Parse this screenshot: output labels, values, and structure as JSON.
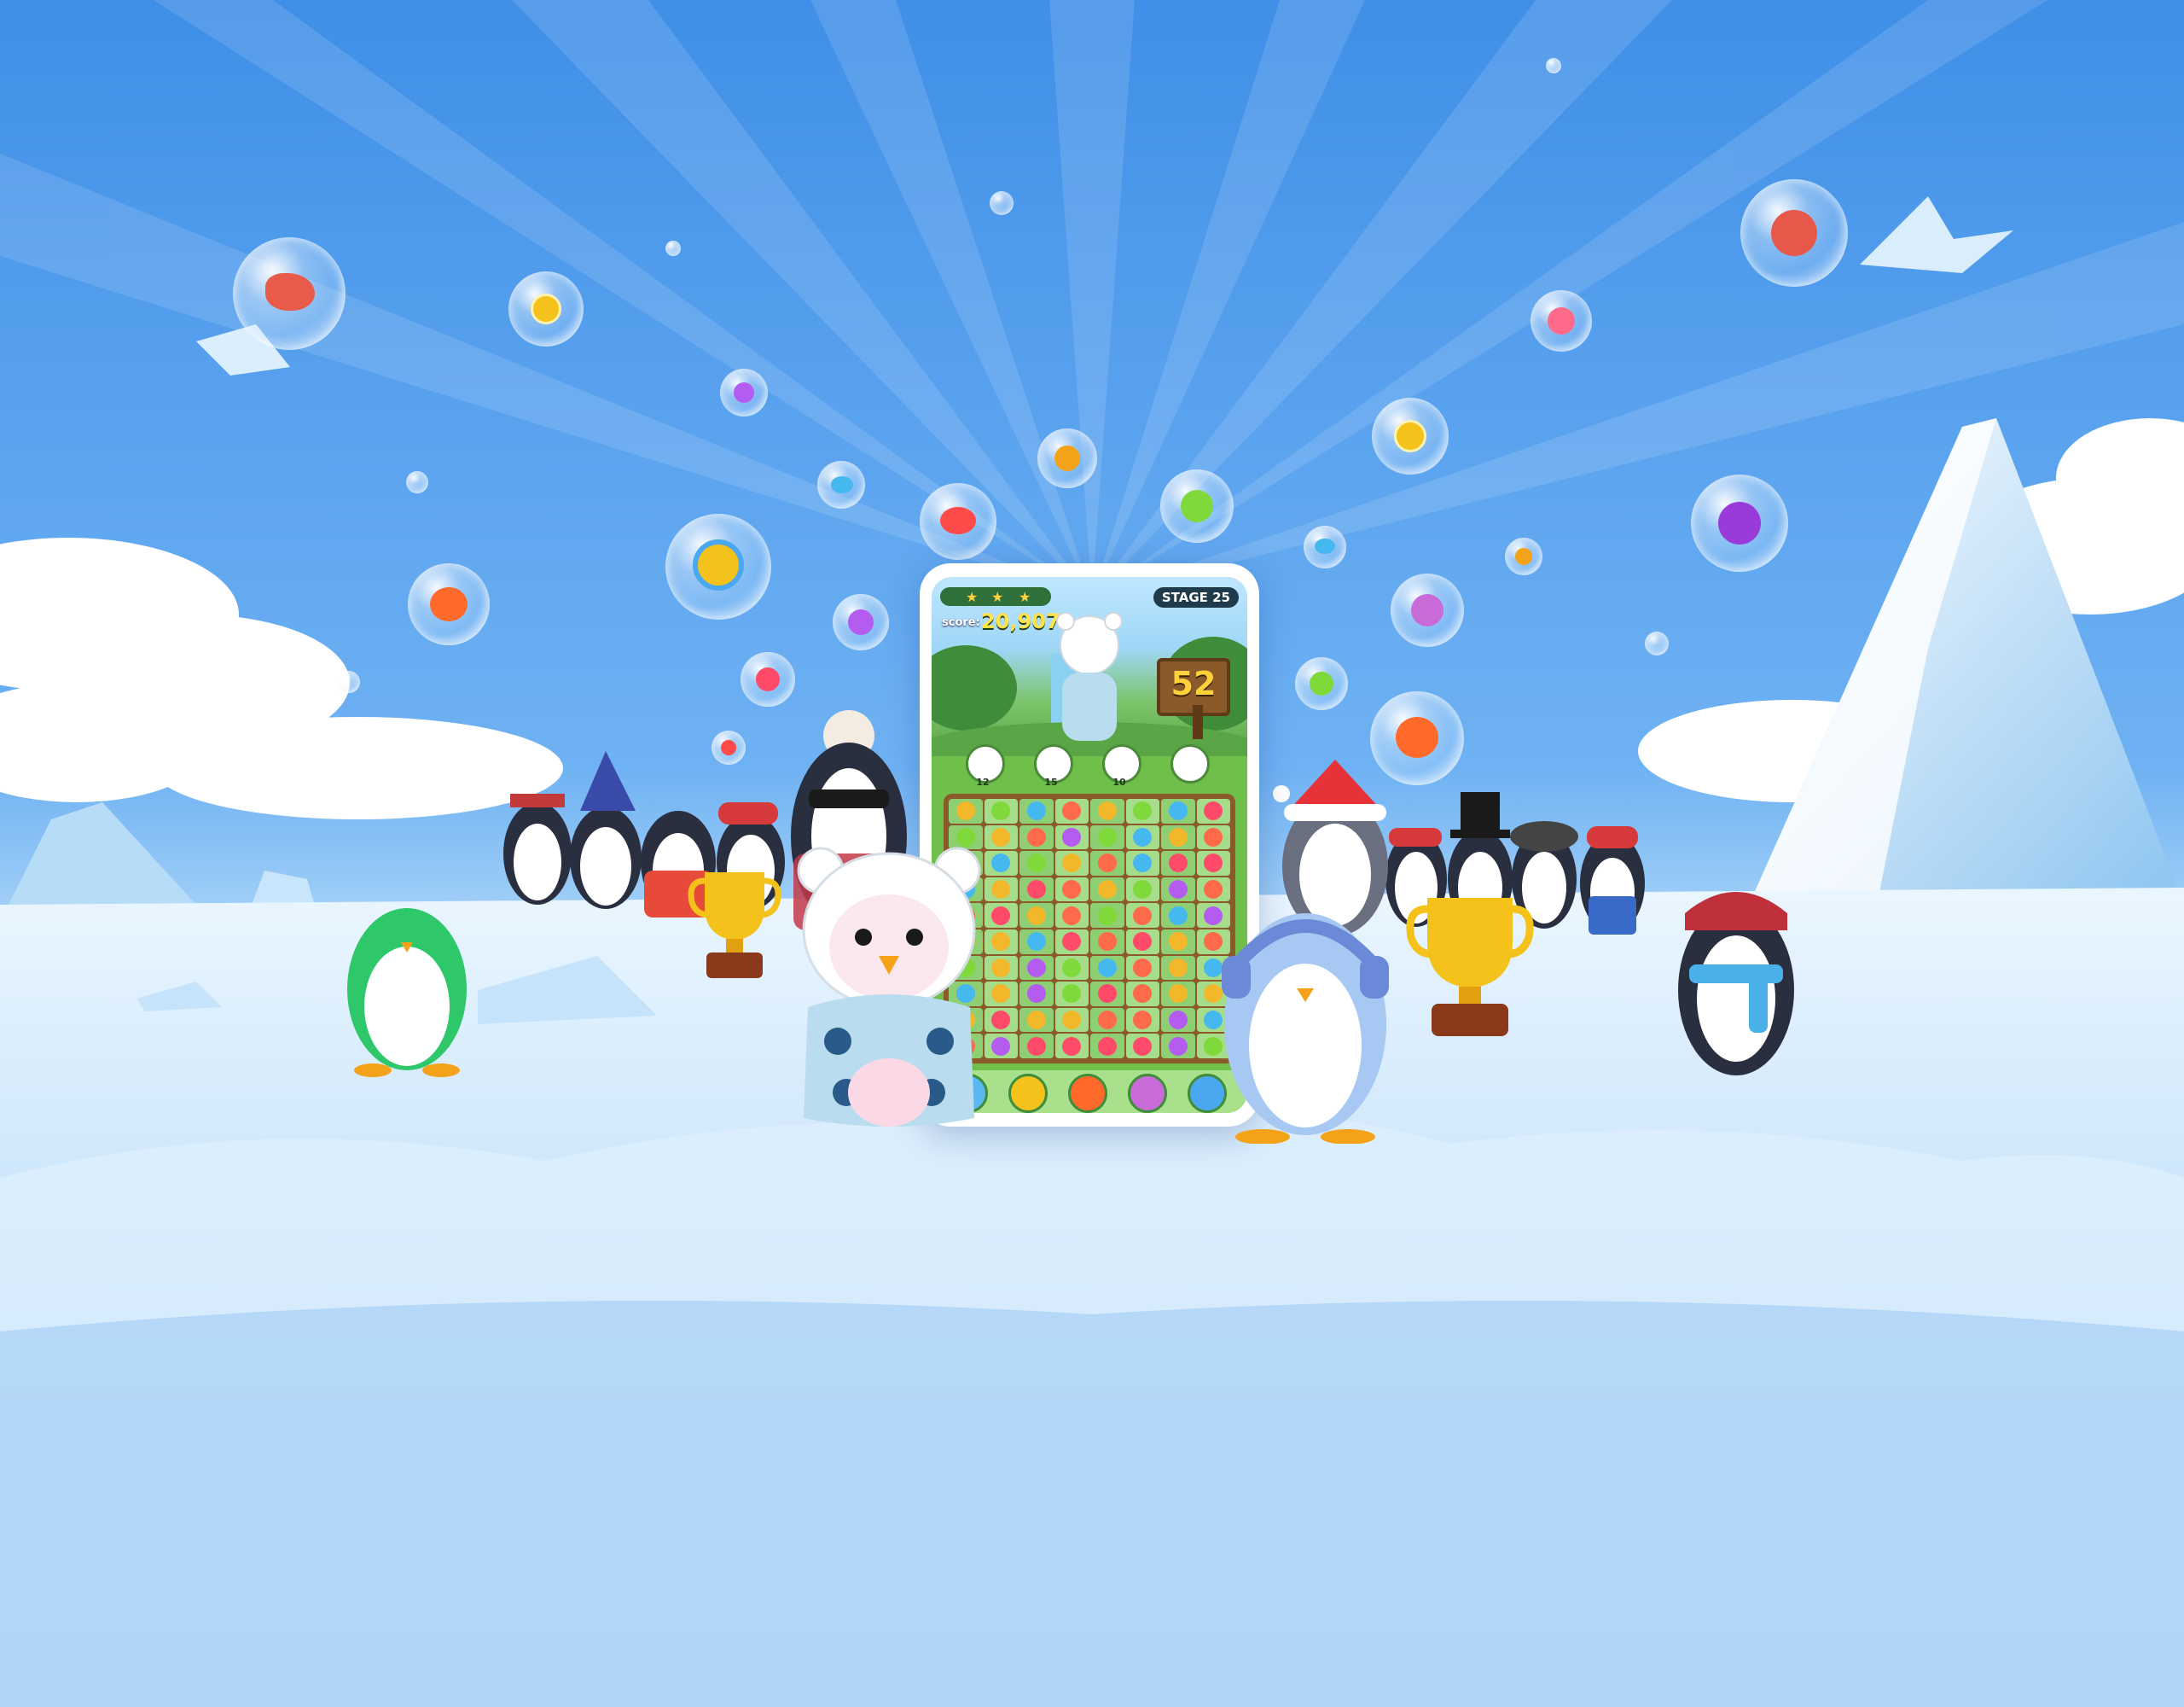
{
  "game": {
    "stage_label": "STAGE 25",
    "score_label": "score:",
    "score_value": "20,907",
    "moves_left": "52",
    "stars_earned": 3,
    "goals": [
      {
        "icon": "shrimp-icon",
        "count": "12"
      },
      {
        "icon": "seaweed-icon",
        "count": "15"
      },
      {
        "icon": "tomato-icon",
        "count": "10"
      },
      {
        "icon": "fish-icon",
        "count": ""
      }
    ],
    "board": {
      "rows": 10,
      "cols": 8,
      "gem_colors": [
        "#46b8f0",
        "#ff6a4a",
        "#f2b72a",
        "#7fd93a",
        "#b55cf0",
        "#ff4a6a"
      ]
    },
    "boosters": [
      "penguin-icon",
      "clock-icon",
      "rocket-icon",
      "fish-icon",
      "settings-icon"
    ]
  },
  "colors": {
    "sky_top": "#3f8fe8",
    "sky_mid": "#6fb2f3",
    "snow": "#e9f6ff",
    "ice": "#9fd2f5",
    "penguin_blue": "#a7c8f2",
    "penguin_green": "#2ec86a",
    "trophy_gold": "#f4c21a"
  }
}
